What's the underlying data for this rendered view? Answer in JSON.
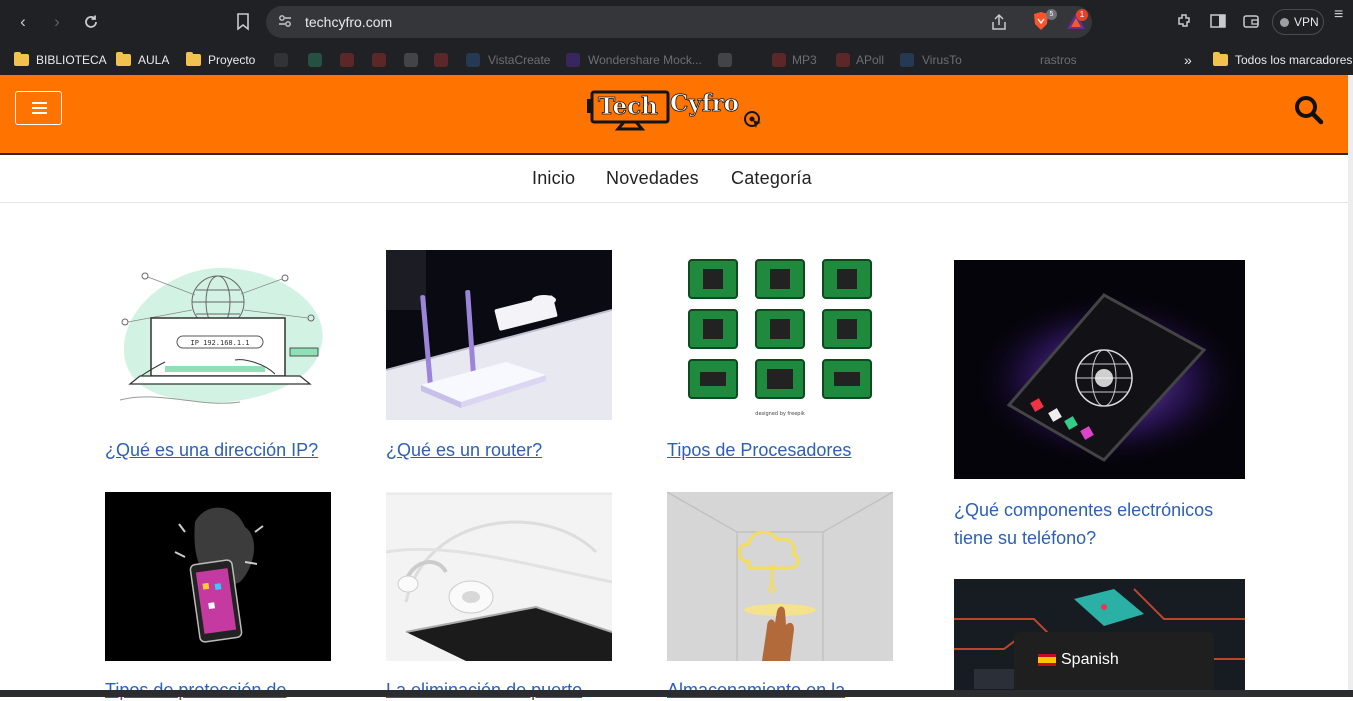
{
  "browser": {
    "url": "techcyfro.com",
    "shields_count": "5",
    "rewards_count": "1",
    "vpn_label": "VPN",
    "bookmarks": [
      "BIBLIOTECA",
      "AULA",
      "Proyecto"
    ],
    "bookmarks_dim": [
      "VistaCreate",
      "Wondershare Mock...",
      "MP3",
      "APoll",
      "VirusTo",
      "rastros"
    ],
    "more_bookmarks": "»",
    "all_bookmarks": "Todos los marcadores"
  },
  "site": {
    "logo_text_1": "Tech",
    "logo_text_2": "Cyfro",
    "menu": [
      "Inicio",
      "Novedades",
      "Categoría"
    ]
  },
  "posts": [
    {
      "title": "¿Qué es una dirección IP?",
      "image": "ip-illustration"
    },
    {
      "title": "¿Qué es un router?",
      "image": "router-photo"
    },
    {
      "title": "Tipos de Procesadores",
      "image": "processors-grid"
    },
    {
      "title": "¿Qué componentes electrónicos tiene su teléfono?",
      "image": "smartphone-hologram"
    },
    {
      "title": "Tipos de protección de",
      "image": "phone-splash"
    },
    {
      "title": "La eliminación de puerto",
      "image": "earphones-phone"
    },
    {
      "title": "Almacenamiento en la",
      "image": "cloud-hand"
    },
    {
      "title": "",
      "image": "circuit-board"
    }
  ],
  "ip_label": "IP 192.168.1.1",
  "freepik_credit": "designed by freepik",
  "language": {
    "label": "Spanish"
  },
  "colors": {
    "brand_orange": "#ff7400",
    "link_blue": "#2b5fb8",
    "chrome_dark": "#202124"
  }
}
